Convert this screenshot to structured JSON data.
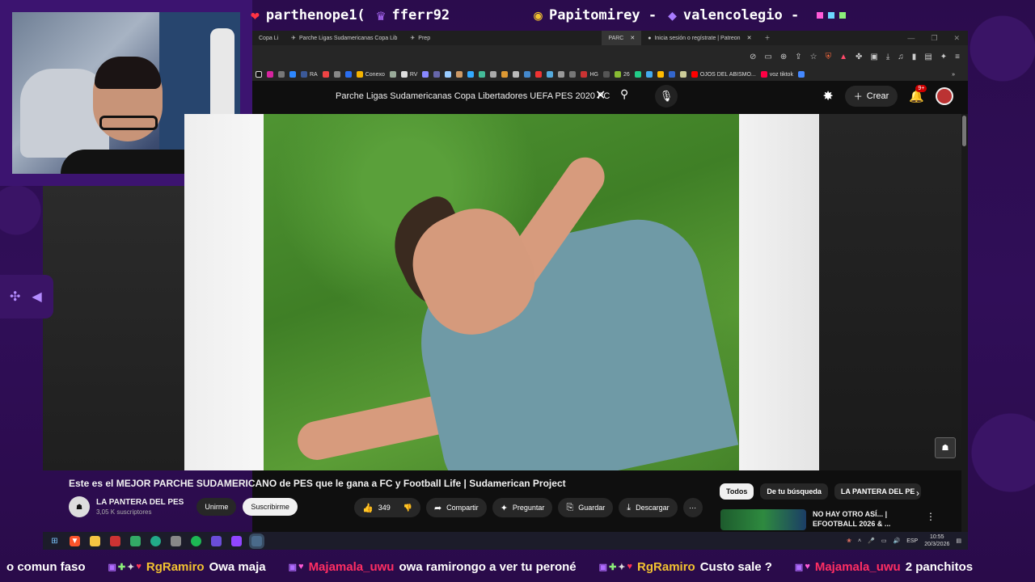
{
  "alerts": [
    {
      "icon": "heart-icon",
      "glyph": "❤",
      "color": "#ff3344",
      "name": "parthenope1("
    },
    {
      "icon": "crown-icon",
      "glyph": "♛",
      "color": "#b06cff",
      "name": "fferr92"
    },
    {
      "icon": "coin-icon",
      "glyph": "◉",
      "color": "#f2c230",
      "name": "Papitomirey -"
    },
    {
      "icon": "gem-icon",
      "glyph": "◆",
      "color": "#a97bff",
      "name": "valencolegio -"
    }
  ],
  "browser": {
    "tabs": [
      {
        "label": "Copa Li"
      },
      {
        "label": "Parche Ligas Sudamericanas Copa Lib"
      },
      {
        "label": "Prep"
      },
      {
        "label": "PARC",
        "active": true
      },
      {
        "label": "Inicia sesión o regístrate | Patreon"
      }
    ],
    "bookmarks": [
      "RA",
      "Conexo",
      "RV",
      "HG",
      "26",
      "OJOS DEL ABISMO...",
      "voz tiktok"
    ]
  },
  "youtube": {
    "search_query": "Parche Ligas Sudamericanas Copa Libertadores UEFA PES 2020 PC",
    "create_label": "Crear",
    "notif_count": "9+",
    "video_title": "Este es el MEJOR PARCHE SUDAMERICANO de PES que le gana a FC y Football Life | Sudamerican Project",
    "channel": {
      "name": "LA PANTERA DEL PES",
      "subs": "3,05 K suscriptores",
      "join": "Unirme",
      "subscribe": "Suscribirme"
    },
    "actions": {
      "likes": "349",
      "share": "Compartir",
      "ask": "Preguntar",
      "save": "Guardar",
      "download": "Descargar"
    },
    "chips": [
      "Todos",
      "De tu búsqueda",
      "LA PANTERA DEL PE"
    ],
    "rec": {
      "title_line1": "NO HAY OTRO ASÍ... |",
      "title_line2": "EFOOTBALL 2026 & ..."
    }
  },
  "taskbar": {
    "lang": "ESP",
    "time": "10:55",
    "date": "20/3/2026"
  },
  "chat": [
    {
      "user": "",
      "text": "o comun faso",
      "color": "#ffffff"
    },
    {
      "user": "RgRamiro",
      "text": "Owa maja",
      "color": "#f2c230"
    },
    {
      "user": "Majamala_uwu",
      "text": "owa ramirongo a ver tu peroné",
      "color": "#ff2e63"
    },
    {
      "user": "RgRamiro",
      "text": "Custo sale ?",
      "color": "#f2c230"
    },
    {
      "user": "Majamala_uwu",
      "text": "2 panchitos",
      "color": "#ff2e63"
    }
  ]
}
